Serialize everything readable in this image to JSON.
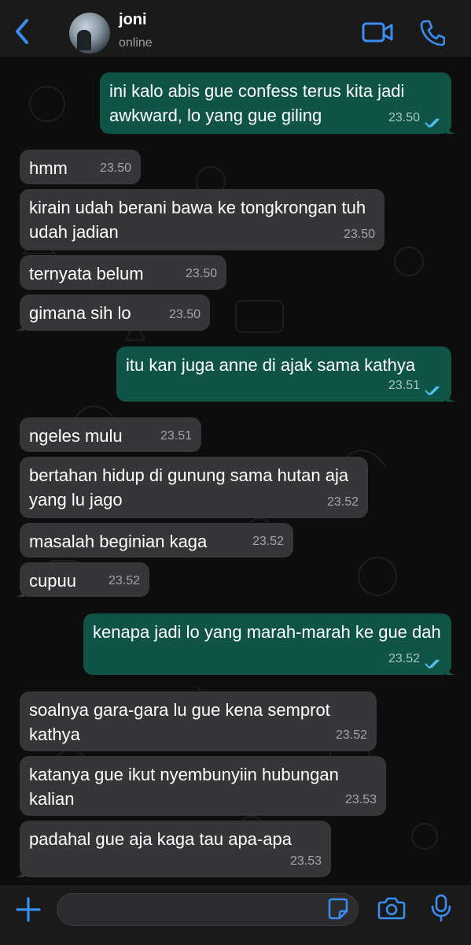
{
  "header": {
    "contact_name": "joni",
    "contact_status": "online",
    "back_icon": "chevron-left-icon",
    "video_icon": "video-camera-icon",
    "call_icon": "phone-icon"
  },
  "messages": [
    {
      "dir": "out",
      "text": "ini kalo abis gue confess terus kita jadi awkward, lo yang gue giling",
      "time": "23.50"
    },
    {
      "dir": "in",
      "text": "hmm",
      "time": "23.50"
    },
    {
      "dir": "in",
      "text": "kirain udah berani bawa ke tongkrongan tuh udah jadian",
      "time": "23.50"
    },
    {
      "dir": "in",
      "text": "ternyata belum",
      "time": "23.50"
    },
    {
      "dir": "in",
      "text": "gimana sih lo",
      "time": "23.50"
    },
    {
      "dir": "out",
      "text": "itu kan juga anne di ajak sama kathya",
      "time": "23.51"
    },
    {
      "dir": "in",
      "text": "ngeles mulu",
      "time": "23.51"
    },
    {
      "dir": "in",
      "text": "bertahan hidup di gunung sama hutan aja yang lu jago",
      "time": "23.52"
    },
    {
      "dir": "in",
      "text": "masalah beginian kaga",
      "time": "23.52"
    },
    {
      "dir": "in",
      "text": "cupuu",
      "time": "23.52"
    },
    {
      "dir": "out",
      "text": "kenapa jadi lo yang marah-marah ke gue dah",
      "time": "23.52"
    },
    {
      "dir": "in",
      "text": "soalnya gara-gara lu gue kena semprot kathya",
      "time": "23.52"
    },
    {
      "dir": "in",
      "text": "katanya gue ikut nyembunyiin hubungan kalian",
      "time": "23.53"
    },
    {
      "dir": "in",
      "text": "padahal gue aja kaga tau apa-apa",
      "time": "23.53"
    }
  ],
  "composer": {
    "value": "",
    "attach_icon": "plus-icon",
    "sticker_icon": "sticker-icon",
    "camera_icon": "camera-icon",
    "mic_icon": "microphone-icon"
  },
  "colors": {
    "accent": "#3b8df2",
    "outgoing_bubble": "#0f5446",
    "incoming_bubble": "#363638",
    "read_tick": "#53bdeb"
  }
}
